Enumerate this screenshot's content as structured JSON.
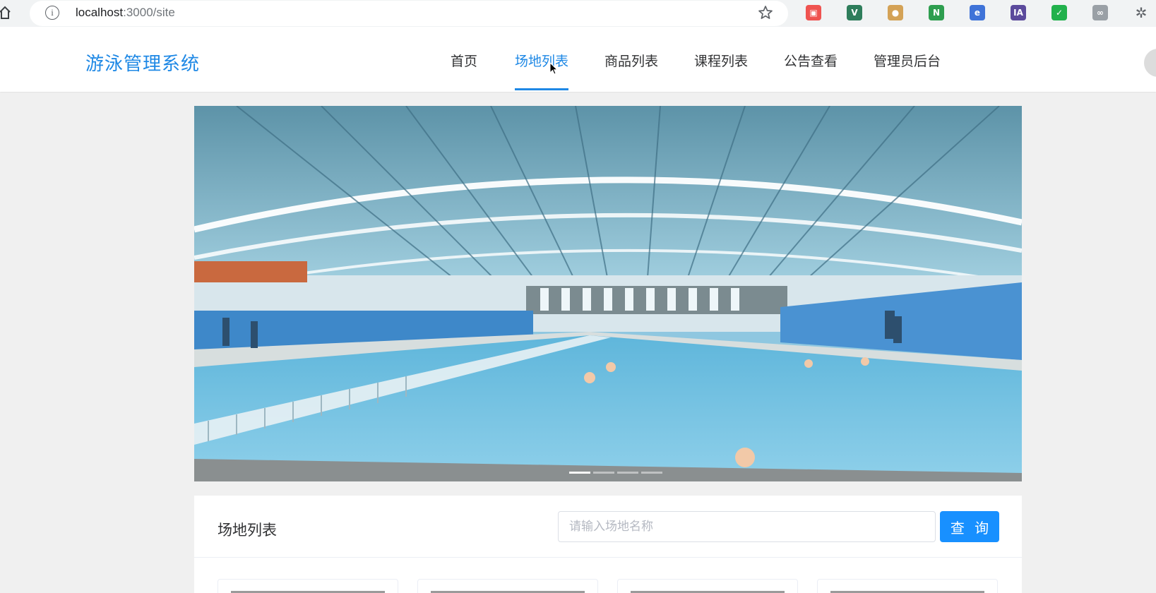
{
  "browser": {
    "url_host": "localhost",
    "url_rest": ":3000/site",
    "extensions": [
      {
        "name": "ext-red-icon",
        "color": "#ef5350",
        "glyph": "▣"
      },
      {
        "name": "vue-devtools-icon",
        "color": "#2e7d5b",
        "glyph": "V"
      },
      {
        "name": "cookie-icon",
        "color": "#d4a256",
        "glyph": "●"
      },
      {
        "name": "ext-green-n-icon",
        "color": "#2e9e4f",
        "glyph": "N"
      },
      {
        "name": "ext-blue-circle-icon",
        "color": "#3f73d8",
        "glyph": "e"
      },
      {
        "name": "ext-ia-icon",
        "color": "#5b4a9c",
        "glyph": "IA"
      },
      {
        "name": "ext-green-check-icon",
        "color": "#22b14c",
        "glyph": "✓"
      },
      {
        "name": "ext-gray-icon",
        "color": "#9aa0a6",
        "glyph": "∞"
      },
      {
        "name": "extensions-puzzle-icon",
        "color": "#5f6368",
        "glyph": "✲"
      }
    ]
  },
  "header": {
    "logo": "游泳管理系统",
    "nav": [
      {
        "label": "首页",
        "active": false
      },
      {
        "label": "场地列表",
        "active": true
      },
      {
        "label": "商品列表",
        "active": false
      },
      {
        "label": "课程列表",
        "active": false
      },
      {
        "label": "公告查看",
        "active": false
      },
      {
        "label": "管理员后台",
        "active": false
      }
    ],
    "accent_color": "#1e88e5"
  },
  "banner": {
    "slide_count": 4,
    "active_slide": 1
  },
  "venue_panel": {
    "title": "场地列表",
    "search_placeholder": "请输入场地名称",
    "search_value": "",
    "search_button": "查 询",
    "button_color": "#1890ff",
    "visible_cards": 4
  }
}
